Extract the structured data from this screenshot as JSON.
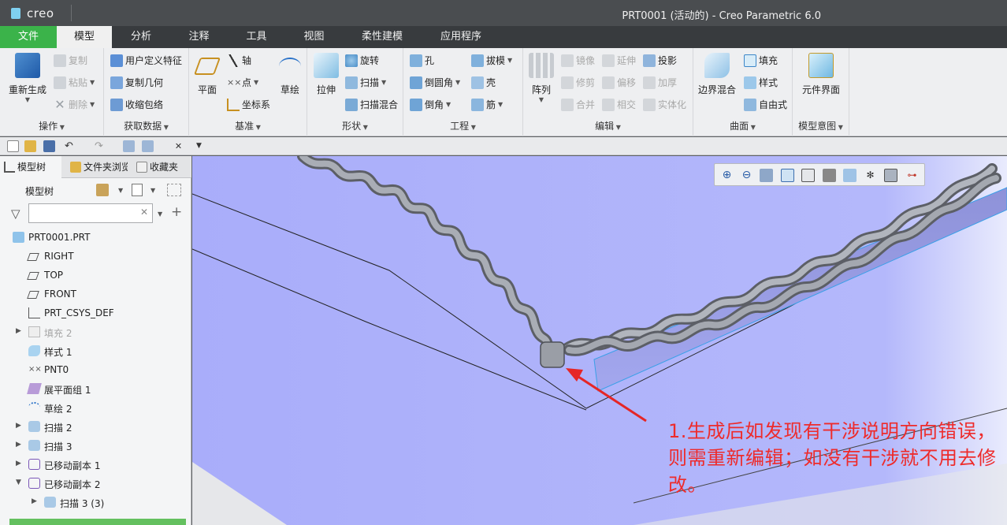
{
  "titlebar": {
    "logo": "creo",
    "title": "PRT0001 (活动的) - Creo Parametric 6.0"
  },
  "tabs": [
    "文件",
    "模型",
    "分析",
    "注释",
    "工具",
    "视图",
    "柔性建模",
    "应用程序"
  ],
  "ribbon": {
    "operations": {
      "label": "操作",
      "regenerate": "重新生成",
      "copy": "复制",
      "paste": "粘贴",
      "delete": "删除"
    },
    "getdata": {
      "label": "获取数据",
      "udf": "用户定义特征",
      "copy_geom": "复制几何",
      "shrinkwrap": "收缩包络"
    },
    "datum": {
      "label": "基准",
      "plane": "平面",
      "axis": "轴",
      "point": "点",
      "csys": "坐标系",
      "sketch": "草绘"
    },
    "shapes": {
      "label": "形状",
      "extrude": "拉伸",
      "revolve": "旋转",
      "sweep": "扫描",
      "swept_blend": "扫描混合"
    },
    "engineering": {
      "label": "工程",
      "hole": "孔",
      "round": "倒圆角",
      "chamfer": "倒角",
      "draft": "拔模",
      "shell": "壳",
      "rib": "筋"
    },
    "editing": {
      "label": "编辑",
      "pattern": "阵列",
      "mirror": "镜像",
      "trim": "修剪",
      "merge": "合并",
      "extend": "延伸",
      "offset": "偏移",
      "intersect": "相交",
      "project": "投影",
      "thicken": "加厚",
      "solidify": "实体化"
    },
    "surfaces": {
      "label": "曲面",
      "boundary_blend": "边界混合",
      "fill": "填充",
      "style": "样式",
      "freestyle": "自由式"
    },
    "intent": {
      "label": "模型意图",
      "component_interface": "元件界面"
    }
  },
  "panel": {
    "tabs": [
      "模型树",
      "文件夹浏览器",
      "收藏夹"
    ],
    "tree_header": "模型树",
    "filter_placeholder": "",
    "tree": [
      {
        "label": "PRT0001.PRT",
        "icon": "part-icon"
      },
      {
        "label": "RIGHT",
        "icon": "datum-plane-icon"
      },
      {
        "label": "TOP",
        "icon": "datum-plane-icon"
      },
      {
        "label": "FRONT",
        "icon": "datum-plane-icon"
      },
      {
        "label": "PRT_CSYS_DEF",
        "icon": "csys-icon"
      },
      {
        "label": "填充 2",
        "icon": "fill-icon"
      },
      {
        "label": "样式 1",
        "icon": "style-icon"
      },
      {
        "label": "PNT0",
        "icon": "point-icon"
      },
      {
        "label": "展平面组 1",
        "icon": "flatten-quilt-icon"
      },
      {
        "label": "草绘 2",
        "icon": "sketch-icon"
      },
      {
        "label": "扫描 2",
        "icon": "sweep-icon"
      },
      {
        "label": "扫描 3",
        "icon": "sweep-icon"
      },
      {
        "label": "已移动副本 1",
        "icon": "moved-copy-icon"
      },
      {
        "label": "已移动副本 2",
        "icon": "moved-copy-icon"
      },
      {
        "label": "扫描 3 (3)",
        "icon": "sweep-icon"
      }
    ]
  },
  "view": {
    "annotation": "1.生成后如发现有干涉说明方向错误，则需重新编辑；如没有干涉就不用去修改。"
  },
  "colors": {
    "file_tab": "#3bb34a",
    "viewport": "#b2b6fb",
    "annotation": "#ee2b2b"
  }
}
